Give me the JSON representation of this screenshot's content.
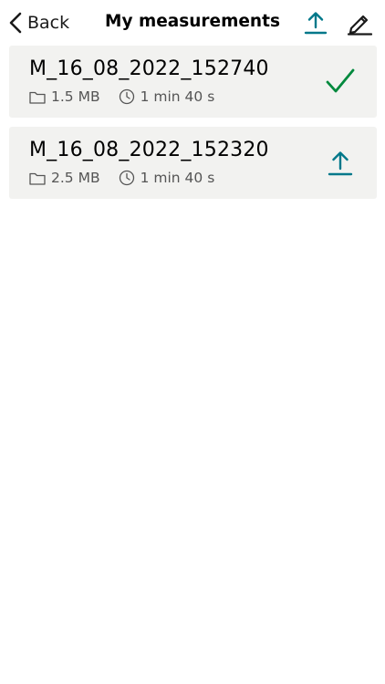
{
  "header": {
    "back_label": "Back",
    "title": "My measurements",
    "icons": {
      "back": "chevron-left-icon",
      "upload_all": "upload-icon",
      "edit": "pencil-icon"
    }
  },
  "measurements": [
    {
      "name": "M_16_08_2022_152740",
      "size": "1.5 MB",
      "duration": "1 min 40 s",
      "status": "uploaded",
      "status_icon": "checkmark-icon"
    },
    {
      "name": "M_16_08_2022_152320",
      "size": "2.5 MB",
      "duration": "1 min 40 s",
      "status": "pending",
      "status_icon": "upload-icon"
    }
  ],
  "colors": {
    "accent": "#00788a",
    "success": "#00893d",
    "item_background": "#f2f2f0",
    "meta_text": "#555555"
  }
}
